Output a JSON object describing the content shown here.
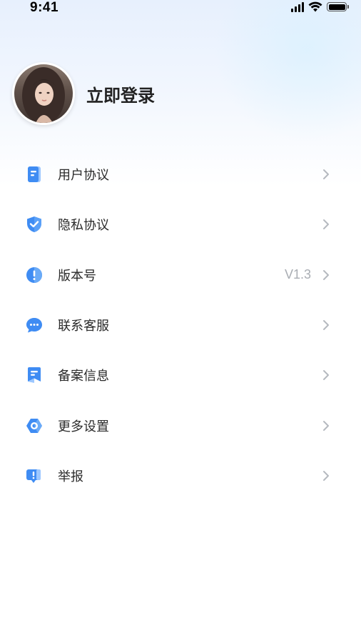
{
  "status_bar": {
    "time": "9:41"
  },
  "profile": {
    "login_label": "立即登录"
  },
  "menu": {
    "items": [
      {
        "label": "用户协议",
        "icon": "document-icon",
        "value": ""
      },
      {
        "label": "隐私协议",
        "icon": "shield-check-icon",
        "value": ""
      },
      {
        "label": "版本号",
        "icon": "info-exclamation-icon",
        "value": "V1.3"
      },
      {
        "label": "联系客服",
        "icon": "chat-bubble-icon",
        "value": ""
      },
      {
        "label": "备案信息",
        "icon": "bookmark-document-icon",
        "value": ""
      },
      {
        "label": "更多设置",
        "icon": "settings-hexagon-icon",
        "value": ""
      },
      {
        "label": "举报",
        "icon": "report-icon",
        "value": ""
      }
    ]
  },
  "colors": {
    "accent": "#3f8cf3",
    "accent_light": "#9cc7ff",
    "text_primary": "#2b2b2b",
    "text_secondary": "#a9adb3",
    "chevron": "#b5b9bf"
  }
}
